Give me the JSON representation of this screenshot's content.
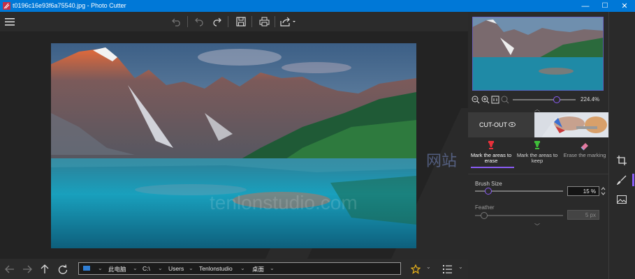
{
  "window": {
    "title": "t0196c16e93f6a75540.jpg - Photo Cutter",
    "minimize": "—",
    "maximize": "☐",
    "close": "✕"
  },
  "toolbar": {
    "menu_icon": "hamburger-icon",
    "undo_icon": "undo-icon",
    "redo_icon": "redo-icon",
    "save_icon": "save-icon",
    "print_icon": "print-icon",
    "share_icon": "share-icon"
  },
  "navigator": {
    "zoom_level": "224.4%",
    "zoom_fraction": 0.7
  },
  "cutout": {
    "label": "CUT-OUT"
  },
  "modes": [
    {
      "line1": "Mark the areas to",
      "line2": "erase",
      "color": "#e8303a",
      "active": true
    },
    {
      "line1": "Mark the areas to",
      "line2": "keep",
      "color": "#3fbf3a",
      "active": false
    },
    {
      "line1": "Erase the marking",
      "line2": "",
      "color": "#e27aa0",
      "active": false
    }
  ],
  "brush": {
    "label": "Brush Size",
    "value": "15 %",
    "fraction": 0.15
  },
  "feather": {
    "label": "Feather",
    "value": "5 px",
    "fraction": 0.1
  },
  "breadcrumb": [
    "此电脑",
    "C:\\",
    "Users",
    "Tenlonstudio",
    "桌面"
  ],
  "watermark": {
    "line1": "网站",
    "line2": "tenlonstudio.com"
  },
  "colors": {
    "accent": "#0078d7",
    "slider_thumb": "#8a5cf5"
  }
}
